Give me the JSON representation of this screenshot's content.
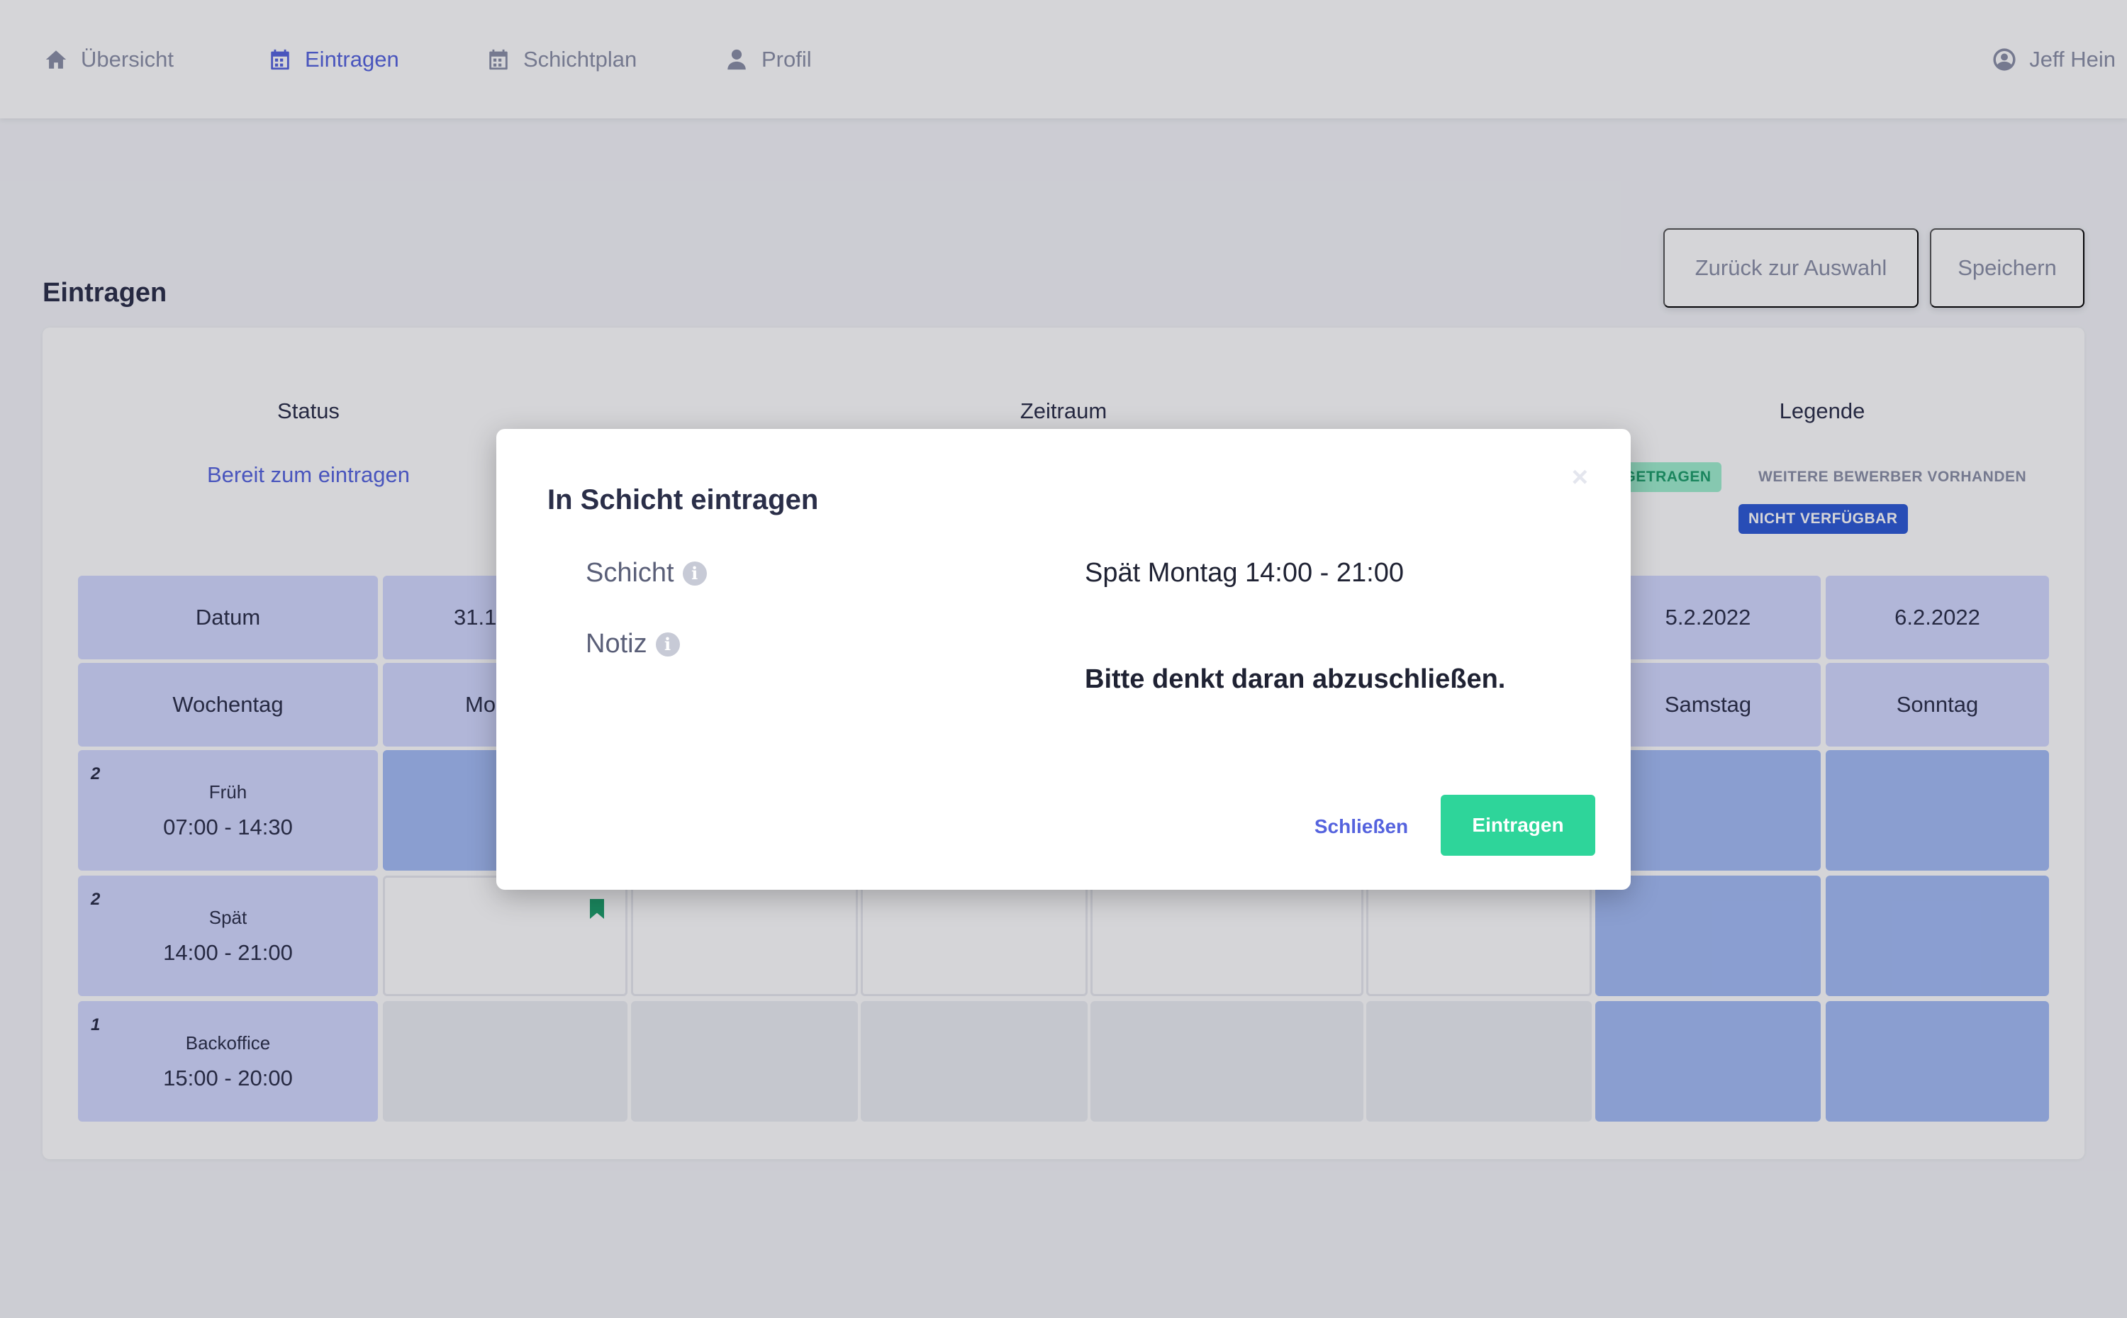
{
  "nav": {
    "items": [
      {
        "label": "Übersicht",
        "icon": "home-icon"
      },
      {
        "label": "Eintragen",
        "icon": "calendar-icon"
      },
      {
        "label": "Schichtplan",
        "icon": "calendar-icon"
      },
      {
        "label": "Profil",
        "icon": "user-icon"
      }
    ],
    "user": "Jeff Hein"
  },
  "page": {
    "title": "Eintragen",
    "back_label": "Zurück zur Auswahl",
    "save_label": "Speichern"
  },
  "info": {
    "status_header": "Status",
    "status_value": "Bereit zum eintragen",
    "range_header": "Zeitraum",
    "legend_header": "Legende",
    "legend_badges": [
      "EINGETRAGEN",
      "WEITERE BEWERBER VORHANDEN",
      "NICHT VERFÜGBAR"
    ]
  },
  "grid": {
    "datum_label": "Datum",
    "wochentag_label": "Wochentag",
    "dates": [
      "31.1",
      "5.2.2022",
      "6.2.2022"
    ],
    "weekdays": [
      "Mo",
      "Samstag",
      "Sonntag"
    ],
    "shifts": [
      {
        "count": "2",
        "name": "Früh",
        "time": "07:00 - 14:30"
      },
      {
        "count": "2",
        "name": "Spät",
        "time": "14:00 - 21:00"
      },
      {
        "count": "1",
        "name": "Backoffice",
        "time": "15:00 - 20:00"
      }
    ]
  },
  "modal": {
    "title": "In Schicht eintragen",
    "close_symbol": "×",
    "schicht_label": "Schicht",
    "schicht_value": "Spät Montag 14:00 - 21:00",
    "notiz_label": "Notiz",
    "notiz_value": "Bitte denkt daran abzuschließen.",
    "info_symbol": "i",
    "cancel_label": "Schließen",
    "submit_label": "Eintragen"
  },
  "colors": {
    "accent": "#5563de",
    "success": "#2ed59a",
    "header_cell": "#d3d9ff",
    "unavailable_cell": "#a4bcf6"
  }
}
